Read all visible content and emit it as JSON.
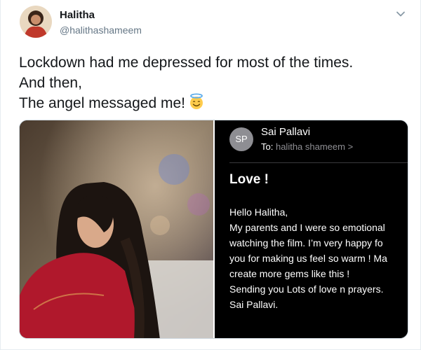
{
  "tweet": {
    "author_name": "Halitha",
    "author_handle": "@halithashameem",
    "text_lines": [
      "Lockdown had me depressed for most of the times.",
      "And then,",
      "The angel messaged me!"
    ],
    "emoji": "smiling-face-with-halo"
  },
  "email": {
    "avatar_initials": "SP",
    "sender": "Sai Pallavi",
    "to_label": "To:",
    "to_value": "halitha shameem >",
    "subject": "Love !",
    "body_lines": [
      "Hello Halitha,",
      "My parents and I were so emotional",
      "watching the film. I’m very happy fo",
      "you for making us feel so warm ! Ma",
      "create more gems like this !",
      "Sending you Lots of love n prayers.",
      "Sai Pallavi."
    ]
  },
  "colors": {
    "link_gray": "#657786",
    "email_background": "#000000",
    "avatar_gray": "#8e8e93",
    "photo_dress_red": "#b0182c"
  }
}
